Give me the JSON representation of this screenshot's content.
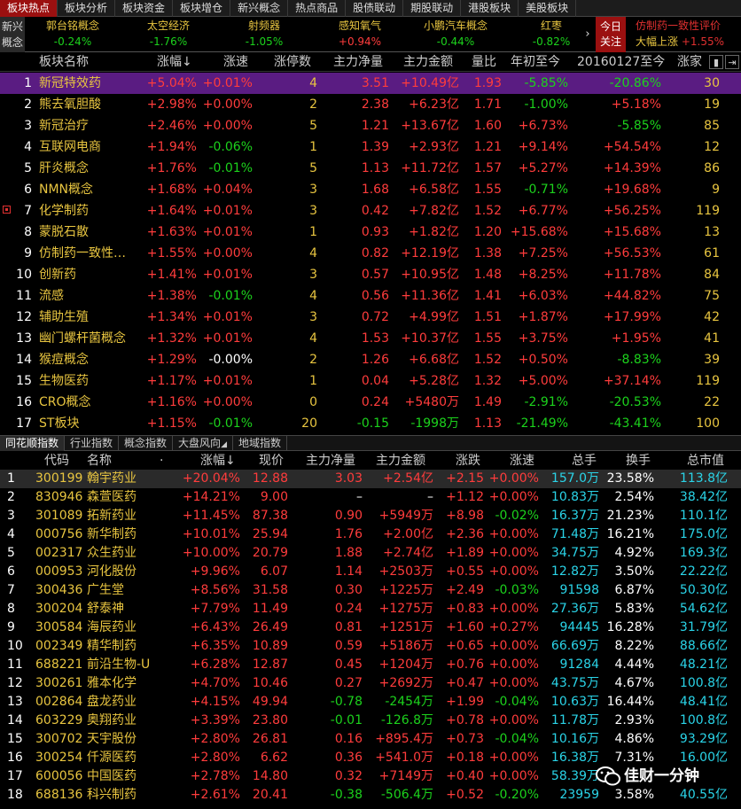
{
  "top_tabs": [
    "板块热点",
    "板块分析",
    "板块资金",
    "板块增仓",
    "新兴概念",
    "热点商品",
    "股债联动",
    "期股联动",
    "港股板块",
    "美股板块"
  ],
  "strip": {
    "left_label": "新兴概念",
    "items": [
      {
        "name": "郭台铭概念",
        "value": "-0.24%"
      },
      {
        "name": "太空经济",
        "value": "-1.76%"
      },
      {
        "name": "射频器",
        "value": "-1.05%"
      },
      {
        "name": "感知氧气",
        "value": "+0.94%"
      },
      {
        "name": "小鹏汽车概念",
        "value": "-0.44%"
      },
      {
        "name": "红枣",
        "value": "-0.82%"
      }
    ],
    "arrow": "›",
    "today_label": "今日关注",
    "right_line1": "仿制药一致性评价",
    "right_line2_prefix": "大幅上涨 ",
    "right_line2_value": "+1.55%"
  },
  "upper_headers": [
    "板块名称",
    "涨幅",
    "涨速",
    "涨停数",
    "主力净量",
    "主力金额",
    "量比",
    "年初至今",
    "20160127至今",
    "涨家"
  ],
  "upper_sort_arrow": "↓",
  "upper_rows": [
    {
      "idx": "1",
      "name": "新冠特效药",
      "chg": "+5.04%",
      "speed": "+0.01%",
      "limit": "4",
      "net": "3.51",
      "amount": "+10.49亿",
      "ratio": "1.93",
      "ytd": "-5.85%",
      "since": "-20.86%",
      "up": "30"
    },
    {
      "idx": "2",
      "name": "熊去氧胆酸",
      "chg": "+2.98%",
      "speed": "+0.00%",
      "limit": "2",
      "net": "2.38",
      "amount": "+6.23亿",
      "ratio": "1.71",
      "ytd": "-1.00%",
      "since": "+5.18%",
      "up": "19"
    },
    {
      "idx": "3",
      "name": "新冠治疗",
      "chg": "+2.46%",
      "speed": "+0.00%",
      "limit": "5",
      "net": "1.21",
      "amount": "+13.67亿",
      "ratio": "1.60",
      "ytd": "+6.73%",
      "since": "-5.85%",
      "up": "85"
    },
    {
      "idx": "4",
      "name": "互联网电商",
      "chg": "+1.94%",
      "speed": "-0.06%",
      "limit": "1",
      "net": "1.39",
      "amount": "+2.93亿",
      "ratio": "1.21",
      "ytd": "+9.14%",
      "since": "+54.54%",
      "up": "12"
    },
    {
      "idx": "5",
      "name": "肝炎概念",
      "chg": "+1.76%",
      "speed": "-0.01%",
      "limit": "5",
      "net": "1.13",
      "amount": "+11.72亿",
      "ratio": "1.57",
      "ytd": "+5.27%",
      "since": "+14.39%",
      "up": "86"
    },
    {
      "idx": "6",
      "name": "NMN概念",
      "chg": "+1.68%",
      "speed": "+0.04%",
      "limit": "3",
      "net": "1.68",
      "amount": "+6.58亿",
      "ratio": "1.55",
      "ytd": "-0.71%",
      "since": "+19.68%",
      "up": "9"
    },
    {
      "idx": "7",
      "name": "化学制药",
      "chg": "+1.64%",
      "speed": "+0.01%",
      "limit": "3",
      "net": "0.42",
      "amount": "+7.82亿",
      "ratio": "1.52",
      "ytd": "+6.77%",
      "since": "+56.25%",
      "up": "119"
    },
    {
      "idx": "8",
      "name": "蒙脱石散",
      "chg": "+1.63%",
      "speed": "+0.01%",
      "limit": "1",
      "net": "0.93",
      "amount": "+1.82亿",
      "ratio": "1.20",
      "ytd": "+15.68%",
      "since": "+15.68%",
      "up": "13"
    },
    {
      "idx": "9",
      "name": "仿制药一致性…",
      "chg": "+1.55%",
      "speed": "+0.00%",
      "limit": "4",
      "net": "0.82",
      "amount": "+12.19亿",
      "ratio": "1.38",
      "ytd": "+7.25%",
      "since": "+56.53%",
      "up": "61"
    },
    {
      "idx": "10",
      "name": "创新药",
      "chg": "+1.41%",
      "speed": "+0.01%",
      "limit": "3",
      "net": "0.57",
      "amount": "+10.95亿",
      "ratio": "1.48",
      "ytd": "+8.25%",
      "since": "+11.78%",
      "up": "84"
    },
    {
      "idx": "11",
      "name": "流感",
      "chg": "+1.38%",
      "speed": "-0.01%",
      "limit": "4",
      "net": "0.56",
      "amount": "+11.36亿",
      "ratio": "1.41",
      "ytd": "+6.03%",
      "since": "+44.82%",
      "up": "75"
    },
    {
      "idx": "12",
      "name": "辅助生殖",
      "chg": "+1.34%",
      "speed": "+0.01%",
      "limit": "3",
      "net": "0.72",
      "amount": "+4.99亿",
      "ratio": "1.51",
      "ytd": "+1.87%",
      "since": "+17.99%",
      "up": "42"
    },
    {
      "idx": "13",
      "name": "幽门螺杆菌概念",
      "chg": "+1.32%",
      "speed": "+0.01%",
      "limit": "4",
      "net": "1.53",
      "amount": "+10.37亿",
      "ratio": "1.55",
      "ytd": "+3.75%",
      "since": "+1.95%",
      "up": "41"
    },
    {
      "idx": "14",
      "name": "猴痘概念",
      "chg": "+1.29%",
      "speed": "-0.00%",
      "limit": "2",
      "net": "1.26",
      "amount": "+6.68亿",
      "ratio": "1.52",
      "ytd": "+0.50%",
      "since": "-8.83%",
      "up": "39"
    },
    {
      "idx": "15",
      "name": "生物医药",
      "chg": "+1.17%",
      "speed": "+0.01%",
      "limit": "1",
      "net": "0.04",
      "amount": "+5.28亿",
      "ratio": "1.32",
      "ytd": "+5.00%",
      "since": "+37.14%",
      "up": "119"
    },
    {
      "idx": "16",
      "name": "CRO概念",
      "chg": "+1.16%",
      "speed": "+0.00%",
      "limit": "0",
      "net": "0.24",
      "amount": "+5480万",
      "ratio": "1.49",
      "ytd": "-2.91%",
      "since": "-20.53%",
      "up": "22"
    },
    {
      "idx": "17",
      "name": "ST板块",
      "chg": "+1.15%",
      "speed": "-0.01%",
      "limit": "20",
      "net": "-0.15",
      "amount": "-1998万",
      "ratio": "1.13",
      "ytd": "-21.49%",
      "since": "-43.41%",
      "up": "100"
    }
  ],
  "bottom_tabs": [
    "同花顺指数",
    "行业指数",
    "概念指数",
    "大盘风向",
    "地域指数"
  ],
  "bottom_tab_arrow": "◢",
  "lower_headers": [
    "代码",
    "名称",
    "涨幅",
    "现价",
    "主力净量",
    "主力金额",
    "涨跌",
    "涨速",
    "总手",
    "换手",
    "总市值"
  ],
  "lower_dot": "·",
  "lower_rows": [
    {
      "idx": "1",
      "code": "300199",
      "name": "翰宇药业",
      "chg": "+20.04%",
      "price": "12.88",
      "net": "3.03",
      "amount": "+2.54亿",
      "diff": "+2.15",
      "speed": "+0.00%",
      "vol": "157.0万",
      "turn": "23.58%",
      "cap": "113.8亿"
    },
    {
      "idx": "2",
      "code": "830946",
      "name": "森萱医药",
      "chg": "+14.21%",
      "price": "9.00",
      "net": "–",
      "amount": "–",
      "diff": "+1.12",
      "speed": "+0.00%",
      "vol": "10.83万",
      "turn": "2.54%",
      "cap": "38.42亿"
    },
    {
      "idx": "3",
      "code": "301089",
      "name": "拓新药业",
      "chg": "+11.45%",
      "price": "87.38",
      "net": "0.90",
      "amount": "+5949万",
      "diff": "+8.98",
      "speed": "-0.02%",
      "vol": "16.37万",
      "turn": "21.23%",
      "cap": "110.1亿"
    },
    {
      "idx": "4",
      "code": "000756",
      "name": "新华制药",
      "chg": "+10.01%",
      "price": "25.94",
      "net": "1.76",
      "amount": "+2.00亿",
      "diff": "+2.36",
      "speed": "+0.00%",
      "vol": "71.48万",
      "turn": "16.21%",
      "cap": "175.0亿"
    },
    {
      "idx": "5",
      "code": "002317",
      "name": "众生药业",
      "chg": "+10.00%",
      "price": "20.79",
      "net": "1.88",
      "amount": "+2.74亿",
      "diff": "+1.89",
      "speed": "+0.00%",
      "vol": "34.75万",
      "turn": "4.92%",
      "cap": "169.3亿"
    },
    {
      "idx": "6",
      "code": "000953",
      "name": "河化股份",
      "chg": "+9.96%",
      "price": "6.07",
      "net": "1.14",
      "amount": "+2503万",
      "diff": "+0.55",
      "speed": "+0.00%",
      "vol": "12.82万",
      "turn": "3.50%",
      "cap": "22.22亿"
    },
    {
      "idx": "7",
      "code": "300436",
      "name": "广生堂",
      "chg": "+8.56%",
      "price": "31.58",
      "net": "0.30",
      "amount": "+1225万",
      "diff": "+2.49",
      "speed": "-0.03%",
      "vol": "91598",
      "turn": "6.87%",
      "cap": "50.30亿"
    },
    {
      "idx": "8",
      "code": "300204",
      "name": "舒泰神",
      "chg": "+7.79%",
      "price": "11.49",
      "net": "0.24",
      "amount": "+1275万",
      "diff": "+0.83",
      "speed": "+0.00%",
      "vol": "27.36万",
      "turn": "5.83%",
      "cap": "54.62亿"
    },
    {
      "idx": "9",
      "code": "300584",
      "name": "海辰药业",
      "chg": "+6.43%",
      "price": "26.49",
      "net": "0.81",
      "amount": "+1251万",
      "diff": "+1.60",
      "speed": "+0.27%",
      "vol": "94445",
      "turn": "16.28%",
      "cap": "31.79亿"
    },
    {
      "idx": "10",
      "code": "002349",
      "name": "精华制药",
      "chg": "+6.35%",
      "price": "10.89",
      "net": "0.59",
      "amount": "+5186万",
      "diff": "+0.65",
      "speed": "+0.00%",
      "vol": "66.69万",
      "turn": "8.22%",
      "cap": "88.66亿"
    },
    {
      "idx": "11",
      "code": "688221",
      "name": "前沿生物-U",
      "chg": "+6.28%",
      "price": "12.87",
      "net": "0.45",
      "amount": "+1204万",
      "diff": "+0.76",
      "speed": "+0.00%",
      "vol": "91284",
      "turn": "4.44%",
      "cap": "48.21亿"
    },
    {
      "idx": "12",
      "code": "300261",
      "name": "雅本化学",
      "chg": "+4.70%",
      "price": "10.46",
      "net": "0.27",
      "amount": "+2692万",
      "diff": "+0.47",
      "speed": "+0.00%",
      "vol": "43.75万",
      "turn": "4.67%",
      "cap": "100.8亿"
    },
    {
      "idx": "13",
      "code": "002864",
      "name": "盘龙药业",
      "chg": "+4.15%",
      "price": "49.94",
      "net": "-0.78",
      "amount": "-2454万",
      "diff": "+1.99",
      "speed": "-0.04%",
      "vol": "10.63万",
      "turn": "16.44%",
      "cap": "48.41亿"
    },
    {
      "idx": "14",
      "code": "603229",
      "name": "奥翔药业",
      "chg": "+3.39%",
      "price": "23.80",
      "net": "-0.01",
      "amount": "-126.8万",
      "diff": "+0.78",
      "speed": "+0.00%",
      "vol": "11.78万",
      "turn": "2.93%",
      "cap": "100.8亿"
    },
    {
      "idx": "15",
      "code": "300702",
      "name": "天宇股份",
      "chg": "+2.80%",
      "price": "26.81",
      "net": "0.16",
      "amount": "+895.4万",
      "diff": "+0.73",
      "speed": "-0.04%",
      "vol": "10.16万",
      "turn": "4.86%",
      "cap": "93.29亿"
    },
    {
      "idx": "16",
      "code": "300254",
      "name": "仟源医药",
      "chg": "+2.80%",
      "price": "6.62",
      "net": "0.36",
      "amount": "+541.0万",
      "diff": "+0.18",
      "speed": "+0.00%",
      "vol": "16.38万",
      "turn": "7.31%",
      "cap": "16.00亿"
    },
    {
      "idx": "17",
      "code": "600056",
      "name": "中国医药",
      "chg": "+2.78%",
      "price": "14.80",
      "net": "0.32",
      "amount": "+7149万",
      "diff": "+0.40",
      "speed": "+0.00%",
      "vol": "58.39万",
      "turn": "",
      "cap": ""
    },
    {
      "idx": "18",
      "code": "688136",
      "name": "科兴制药",
      "chg": "+2.61%",
      "price": "20.41",
      "net": "-0.38",
      "amount": "-506.4万",
      "diff": "+0.52",
      "speed": "-0.20%",
      "vol": "23959",
      "turn": "3.58%",
      "cap": "40.55亿"
    }
  ],
  "watermark": "佳财一分钟",
  "colors": {
    "up": "#ff3c3c",
    "down": "#1cd21c",
    "name": "#e8c540",
    "volume": "#2ad4e8",
    "selected_row": "#5a1c82",
    "active_tab": "#9b1010"
  }
}
